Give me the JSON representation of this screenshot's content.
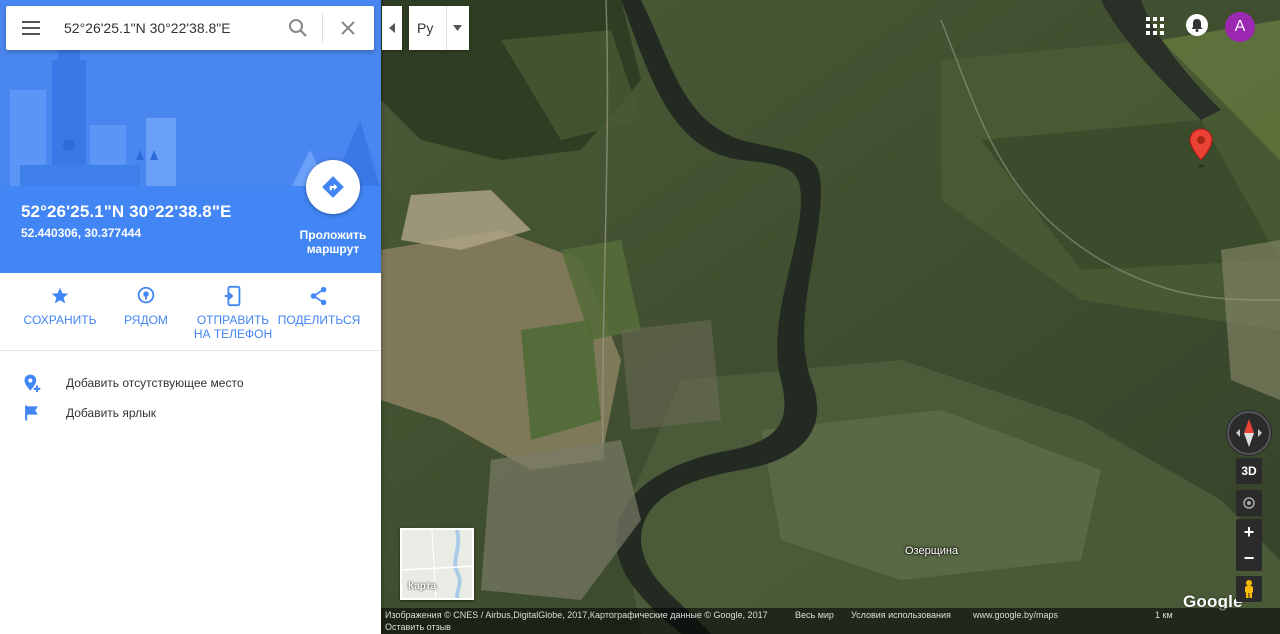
{
  "search": {
    "value": "52°26'25.1\"N 30°22'38.8\"E",
    "menu_icon": "hamburger-menu-icon",
    "search_icon": "search-icon",
    "clear_icon": "close-icon"
  },
  "place": {
    "title": "52°26'25.1\"N 30°22'38.8\"E",
    "decimal": "52.440306, 30.377444",
    "route_label": "Проложить маршрут"
  },
  "actions": [
    {
      "label": "СОХРАНИТЬ",
      "icon": "star-icon"
    },
    {
      "label": "РЯДОМ",
      "icon": "nearby-pin-icon"
    },
    {
      "label": "ОТПРАВИТЬ НА ТЕЛЕФОН",
      "icon": "send-to-phone-icon"
    },
    {
      "label": "ПОДЕЛИТЬСЯ",
      "icon": "share-icon"
    }
  ],
  "add_links": [
    {
      "label": "Добавить отсутствующее место",
      "icon": "add-place-icon"
    },
    {
      "label": "Добавить ярлык",
      "icon": "flag-icon"
    }
  ],
  "map": {
    "language": "Ру",
    "avatar_letter": "A",
    "village_label": "Озерщина",
    "minimap_label": "Карта",
    "logo": "Google",
    "btn_3d": "3D",
    "zoom_in": "+",
    "zoom_out": "−"
  },
  "footer": {
    "attribution": "Изображения © CNES / Airbus,DigitalGlobe, 2017,Картографические данные © Google, 2017",
    "world": "Весь мир",
    "terms": "Условия использования",
    "site": "www.google.by/maps",
    "scale": "1 км",
    "feedback": "Оставить отзыв"
  },
  "colors": {
    "accent": "#4285f4",
    "pin": "#ea4335",
    "avatar": "#9c27b0"
  }
}
